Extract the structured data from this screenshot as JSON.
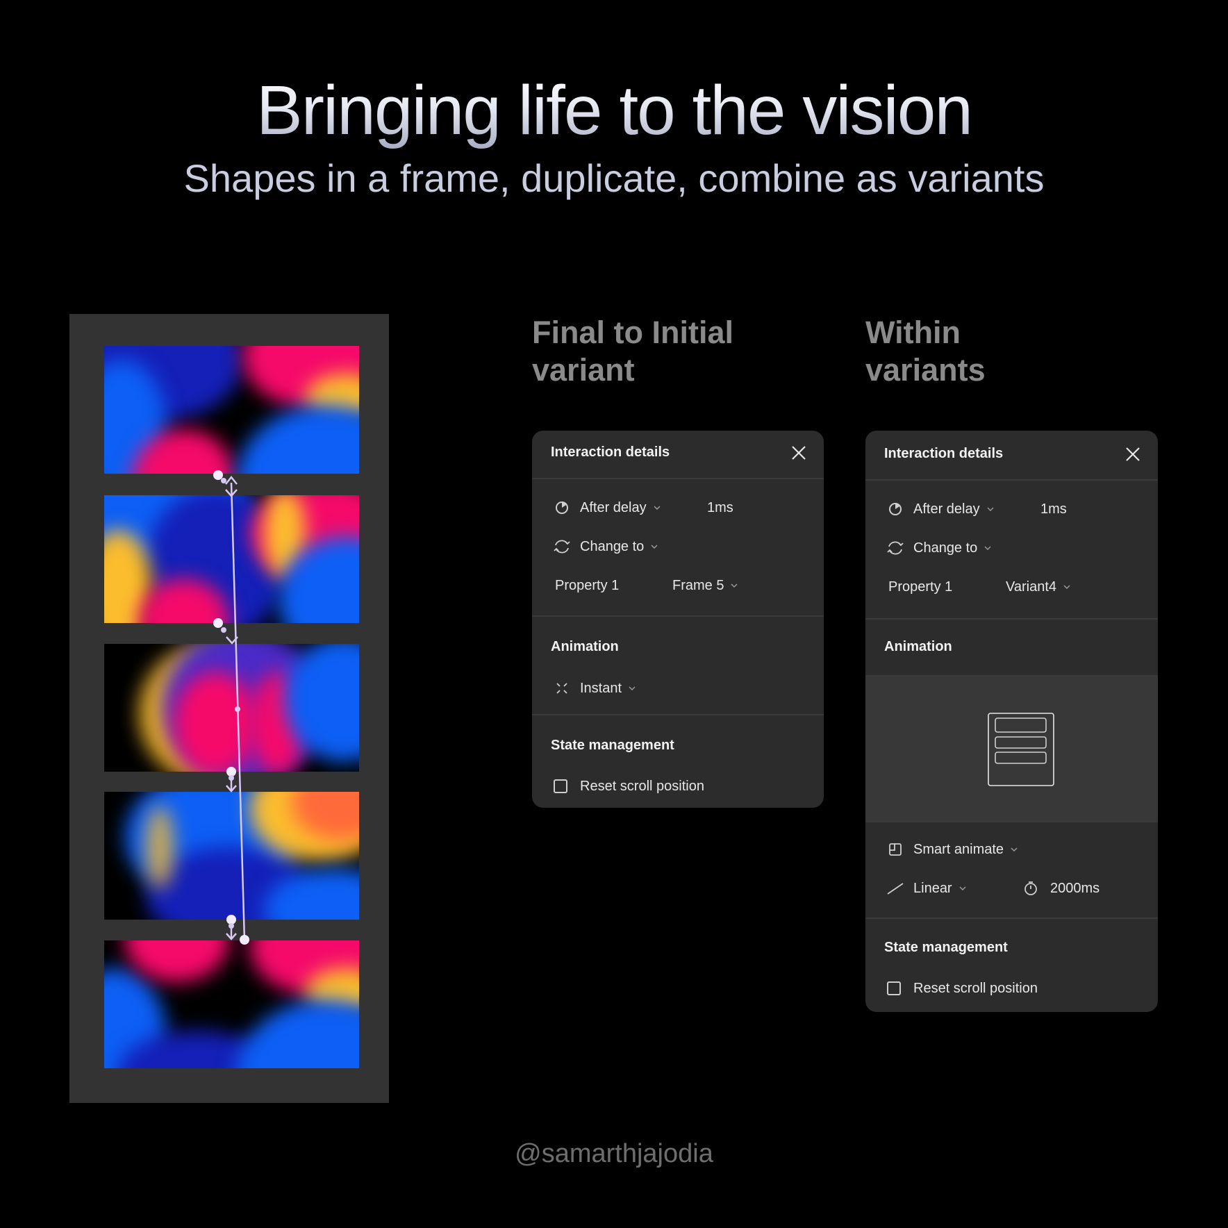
{
  "title": "Bringing life to the vision",
  "subtitle": "Shapes in a frame, duplicate, combine as variants",
  "left_frame": {
    "thumbnails": [
      "Variant 1",
      "Variant 2",
      "Variant 3",
      "Variant 4",
      "Variant 5"
    ],
    "colors": {
      "blue": "#0d5ff5",
      "deep_blue": "#1420b8",
      "pink": "#f50a6a",
      "yellow": "#fbbd2e",
      "orange": "#ff6a3a",
      "connector": "#d9c9f5"
    }
  },
  "panel_final": {
    "heading_line1": "Final to Initial",
    "heading_line2": "variant",
    "header_title": "Interaction details",
    "trigger": {
      "label": "After delay",
      "value": "1ms"
    },
    "action": {
      "label": "Change to"
    },
    "property": {
      "name": "Property 1",
      "value": "Frame 5"
    },
    "animation_title": "Animation",
    "animation": {
      "label": "Instant"
    },
    "state_title": "State management",
    "reset_scroll": {
      "label": "Reset scroll position",
      "checked": false
    }
  },
  "panel_within": {
    "heading_line1": "Within",
    "heading_line2": "variants",
    "header_title": "Interaction details",
    "trigger": {
      "label": "After delay",
      "value": "1ms"
    },
    "action": {
      "label": "Change to"
    },
    "property": {
      "name": "Property 1",
      "value": "Variant4"
    },
    "animation_title": "Animation",
    "animation": {
      "label": "Smart animate"
    },
    "easing": {
      "label": "Linear"
    },
    "duration": {
      "value": "2000ms"
    },
    "state_title": "State management",
    "reset_scroll": {
      "label": "Reset scroll position",
      "checked": false
    }
  },
  "footer": "@samarthjajodia"
}
